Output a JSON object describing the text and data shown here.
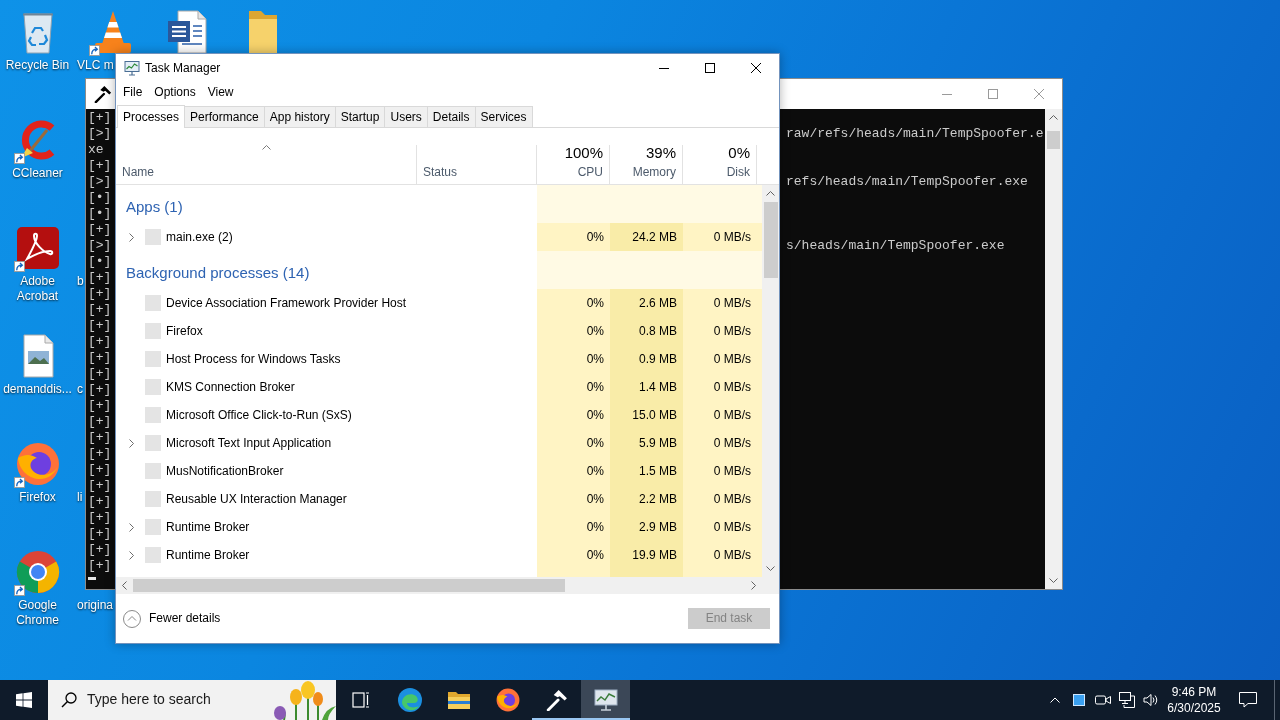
{
  "desktop": {
    "rows": [
      [
        {
          "kind": "recycle-bin",
          "label": "Recycle Bin",
          "shortcut": false
        },
        {
          "kind": "vlc",
          "label": "VLC m",
          "shortcut": true
        },
        {
          "kind": "word",
          "shortcut": false
        },
        {
          "kind": "folder",
          "shortcut": false
        }
      ],
      [
        {
          "kind": "ccleaner",
          "label": "CCleaner",
          "shortcut": true
        }
      ],
      [
        {
          "kind": "acrobat",
          "label": "Adobe Acrobat",
          "shortcut": true
        },
        {
          "kind": "hidden",
          "label": "b"
        }
      ],
      [
        {
          "kind": "image-file",
          "label": "demanddis...",
          "shortcut": false
        },
        {
          "kind": "hidden",
          "label": "c"
        }
      ],
      [
        {
          "kind": "firefox",
          "label": "Firefox",
          "shortcut": true
        },
        {
          "kind": "hidden",
          "label": "li"
        }
      ],
      [
        {
          "kind": "chrome",
          "label": "Google Chrome",
          "shortcut": true
        },
        {
          "kind": "hidden",
          "label": "origina"
        }
      ]
    ]
  },
  "console": {
    "active": false,
    "lines": [
      {
        "left_part": "[+]"
      },
      {
        "left_part": "[>]",
        "right_part": "raw/refs/heads/main/TempSpoofer.e"
      },
      {
        "left_part": "xe"
      },
      {
        "left_part": "[+]"
      },
      {
        "left_part": "[>]",
        "right_part": "refs/heads/main/TempSpoofer.exe"
      },
      {
        "left_part": "[•]"
      },
      {
        "left_part": "[•]"
      },
      {
        "left_part": "[+]"
      },
      {
        "left_part": "[>]",
        "right_part": "s/heads/main/TempSpoofer.exe"
      },
      {
        "left_part": "[•]"
      },
      {
        "left_part": "[+]"
      },
      {
        "left_part": "[+]"
      },
      {
        "left_part": "[+]"
      },
      {
        "left_part": "[+]"
      },
      {
        "left_part": "[+]"
      },
      {
        "left_part": "[+]"
      },
      {
        "left_part": "[+]"
      },
      {
        "left_part": "[+]"
      },
      {
        "left_part": "[+]"
      },
      {
        "left_part": "[+]"
      },
      {
        "left_part": "[+]"
      },
      {
        "left_part": "[+]"
      },
      {
        "left_part": "[+]"
      },
      {
        "left_part": "[+]"
      },
      {
        "left_part": "[+]"
      },
      {
        "left_part": "[+]"
      },
      {
        "left_part": "[+]"
      },
      {
        "left_part": "[+]"
      },
      {
        "left_part": "[+]"
      }
    ]
  },
  "task_manager": {
    "active": true,
    "title": "Task Manager",
    "menu": [
      "File",
      "Options",
      "View"
    ],
    "tabs": [
      {
        "label": "Processes",
        "selected": true
      },
      {
        "label": "Performance",
        "selected": false
      },
      {
        "label": "App history",
        "selected": false
      },
      {
        "label": "Startup",
        "selected": false
      },
      {
        "label": "Users",
        "selected": false
      },
      {
        "label": "Details",
        "selected": false
      },
      {
        "label": "Services",
        "selected": false
      }
    ],
    "columns": [
      {
        "label": "Name",
        "sorted": true
      },
      {
        "label": "Status",
        "sorted": false
      },
      {
        "label": "CPU",
        "usage": "100%",
        "sorted": false
      },
      {
        "label": "Memory",
        "usage": "39%",
        "sorted": false
      },
      {
        "label": "Disk",
        "usage": "0%",
        "sorted": false
      }
    ],
    "groups": [
      {
        "title": "Apps (1)",
        "processes": [
          {
            "name": "main.exe (2)",
            "expandable": true,
            "cpu": "0%",
            "memory": "24.2 MB",
            "disk": "0 MB/s"
          }
        ]
      },
      {
        "title": "Background processes (14)",
        "processes": [
          {
            "name": "Device Association Framework Provider Host",
            "expandable": false,
            "cpu": "0%",
            "memory": "2.6 MB",
            "disk": "0 MB/s"
          },
          {
            "name": "Firefox",
            "expandable": false,
            "cpu": "0%",
            "memory": "0.8 MB",
            "disk": "0 MB/s"
          },
          {
            "name": "Host Process for Windows Tasks",
            "expandable": false,
            "cpu": "0%",
            "memory": "0.9 MB",
            "disk": "0 MB/s"
          },
          {
            "name": "KMS Connection Broker",
            "expandable": false,
            "cpu": "0%",
            "memory": "1.4 MB",
            "disk": "0 MB/s"
          },
          {
            "name": "Microsoft Office Click-to-Run (SxS)",
            "expandable": false,
            "cpu": "0%",
            "memory": "15.0 MB",
            "disk": "0 MB/s"
          },
          {
            "name": "Microsoft Text Input Application",
            "expandable": true,
            "cpu": "0%",
            "memory": "5.9 MB",
            "disk": "0 MB/s"
          },
          {
            "name": "MusNotificationBroker",
            "expandable": false,
            "cpu": "0%",
            "memory": "1.5 MB",
            "disk": "0 MB/s"
          },
          {
            "name": "Reusable UX Interaction Manager",
            "expandable": false,
            "cpu": "0%",
            "memory": "2.2 MB",
            "disk": "0 MB/s"
          },
          {
            "name": "Runtime Broker",
            "expandable": true,
            "cpu": "0%",
            "memory": "2.9 MB",
            "disk": "0 MB/s"
          },
          {
            "name": "Runtime Broker",
            "expandable": true,
            "cpu": "0%",
            "memory": "19.9 MB",
            "disk": "0 MB/s"
          }
        ]
      }
    ],
    "footer": {
      "toggle": "Fewer details",
      "end_task": {
        "label": "End task",
        "disabled": true
      }
    }
  },
  "taskbar": {
    "search": {
      "placeholder": "Type here to search"
    },
    "apps": [
      {
        "kind": "task-view",
        "selected": false,
        "running": false
      },
      {
        "kind": "edge",
        "selected": false,
        "running": false
      },
      {
        "kind": "explorer",
        "selected": false,
        "running": false
      },
      {
        "kind": "firefox",
        "selected": false,
        "running": false
      },
      {
        "kind": "console",
        "selected": false,
        "running": true
      },
      {
        "kind": "task-manager",
        "selected": true,
        "running": true
      }
    ],
    "clock": {
      "time": "9:46 PM",
      "date": "6/30/2025"
    }
  }
}
